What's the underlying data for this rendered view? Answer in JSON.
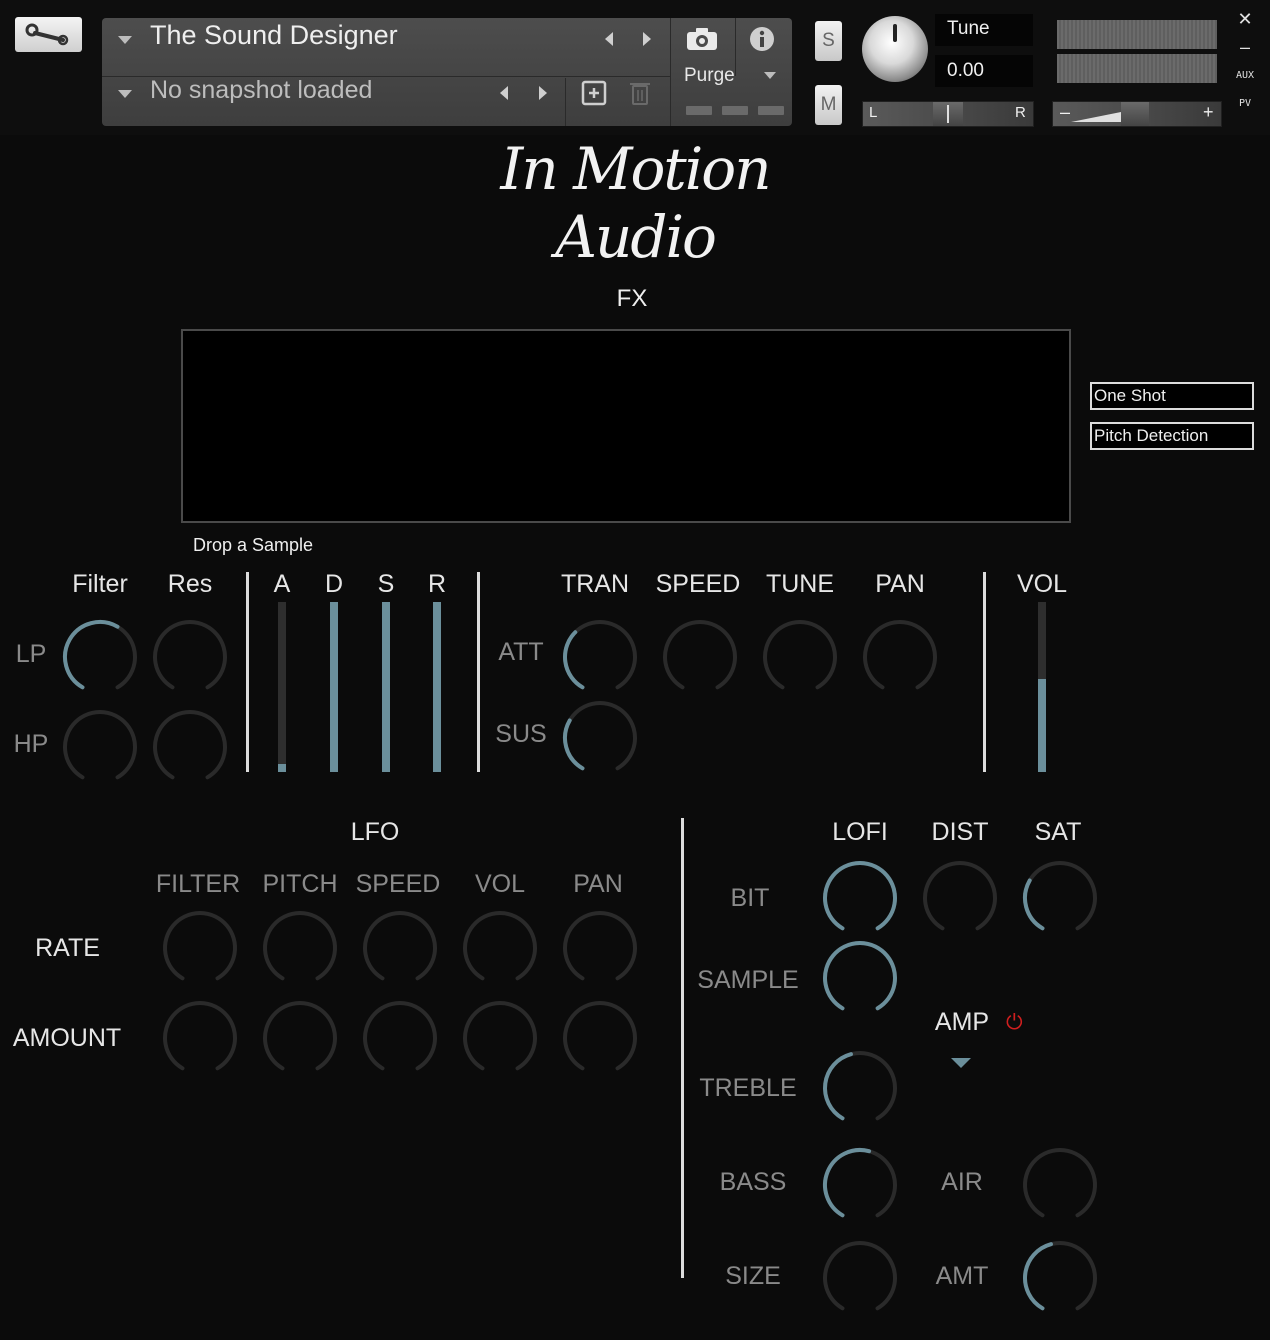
{
  "header": {
    "instrument_name": "The Sound Designer",
    "snapshot_text": "No snapshot loaded",
    "purge_label": "Purge",
    "solo_label": "S",
    "mute_label": "M",
    "tune_label": "Tune",
    "tune_value": "0.00",
    "pan_left_label": "L",
    "pan_right_label": "R",
    "vol_minus_label": "–",
    "vol_plus_label": "+",
    "close_glyph": "✕",
    "minimize_glyph": "–",
    "aux_label": "AUX",
    "pv_label": "PV"
  },
  "logo": {
    "text": "In Motion Audio"
  },
  "fx": {
    "title": "FX",
    "drop_label": "Drop a Sample",
    "one_shot_label": "One Shot",
    "pitch_detection_label": "Pitch Detection"
  },
  "filter": {
    "filter_label": "Filter",
    "res_label": "Res",
    "lp_label": "LP",
    "hp_label": "HP",
    "lp_filter_value": 0.6,
    "lp_res_value": 0.0,
    "hp_filter_value": 0.0,
    "hp_res_value": 0.0
  },
  "adsr": {
    "a_label": "A",
    "d_label": "D",
    "s_label": "S",
    "r_label": "R",
    "a_value": 0.05,
    "d_value": 1.0,
    "s_value": 1.0,
    "r_value": 1.0
  },
  "transient": {
    "tran_label": "TRAN",
    "speed_label": "SPEED",
    "tune_label": "TUNE",
    "pan_label": "PAN",
    "att_label": "ATT",
    "sus_label": "SUS",
    "att_value": 0.35,
    "speed_value": 0.0,
    "tune_value": 0.0,
    "pan_value": 0.0,
    "sus_value": 0.3
  },
  "volume": {
    "vol_label": "VOL",
    "vol_value": 0.55
  },
  "lfo": {
    "title": "LFO",
    "col_filter": "FILTER",
    "col_pitch": "PITCH",
    "col_speed": "SPEED",
    "col_vol": "VOL",
    "col_pan": "PAN",
    "rate_label": "RATE",
    "amount_label": "AMOUNT"
  },
  "effects": {
    "lofi_label": "LOFI",
    "dist_label": "DIST",
    "sat_label": "SAT",
    "bit_label": "BIT",
    "sample_label": "SAMPLE",
    "amp_label": "AMP",
    "power_glyph": "⏻",
    "treble_label": "TREBLE",
    "bass_label": "BASS",
    "air_label": "AIR",
    "size_label": "SIZE",
    "amt_label": "AMT",
    "lofi_value": 1.0,
    "dist_value": 0.0,
    "sat_value": 0.3,
    "sample_value": 1.0,
    "treble_value": 0.45,
    "bass_value": 0.55,
    "air_value": 0.0,
    "size_value": 0.0,
    "amt_value": 0.45
  },
  "colors": {
    "accent": "#6b8f9b",
    "track": "#2a2a2a",
    "power": "#d11f1f",
    "background": "#0b0b0b"
  }
}
